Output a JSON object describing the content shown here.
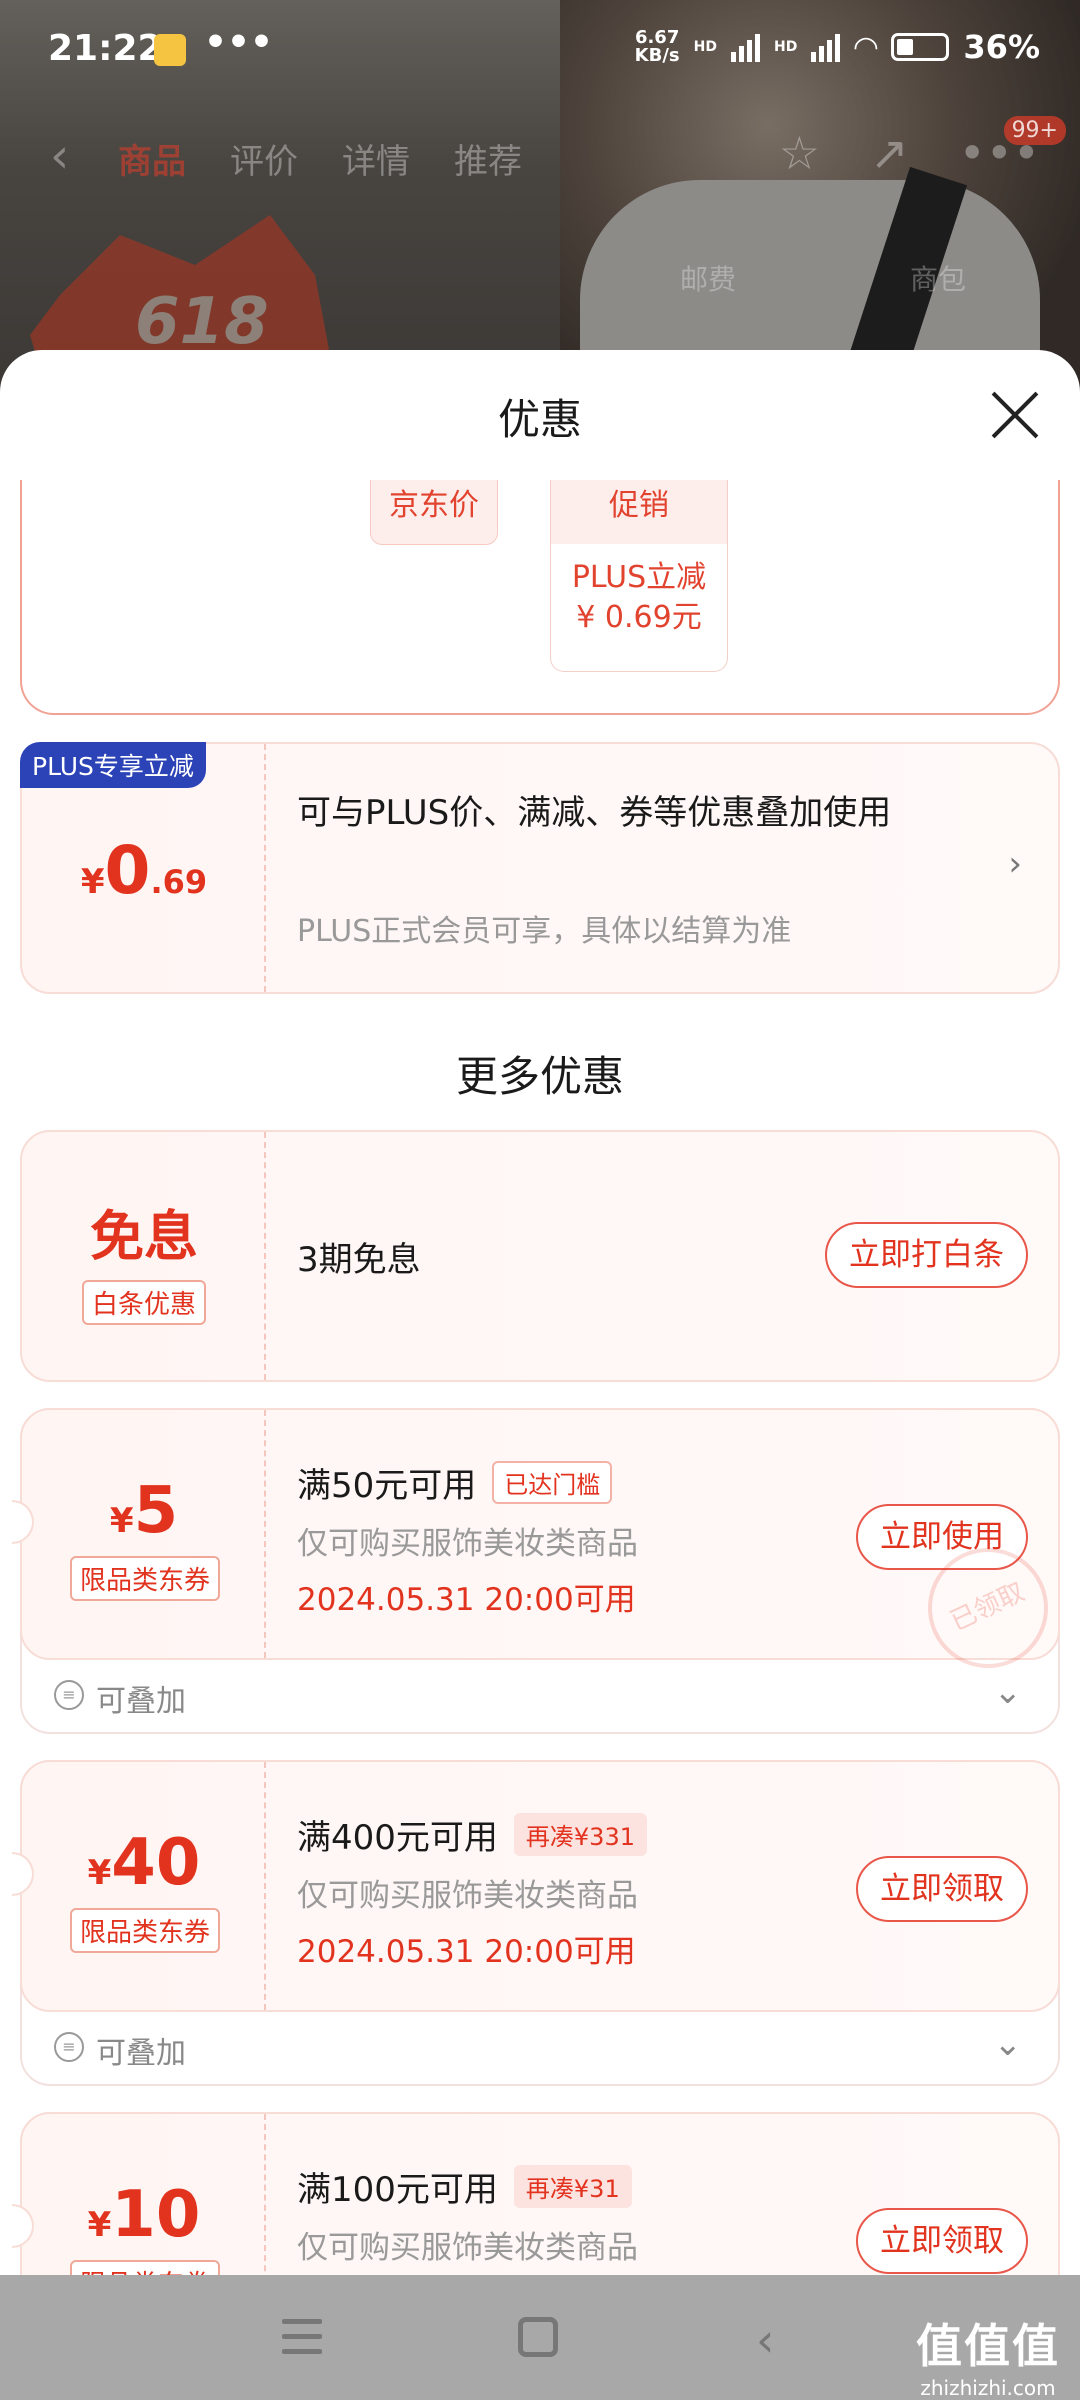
{
  "status": {
    "time": "21:22",
    "dots": "•••",
    "net_speed_top": "6.67",
    "net_speed_bottom": "KB/s",
    "hd1": "HD",
    "hd2": "HD",
    "battery": "36%"
  },
  "bg_nav": {
    "back": "‹",
    "tabs": [
      "商品",
      "评价",
      "详情",
      "推荐"
    ],
    "badge_count": "99+",
    "star": "☆",
    "share": "↗",
    "more": "•••"
  },
  "bg_badge": "618",
  "bg_tags": [
    "邮费",
    "商包"
  ],
  "sheet": {
    "title": "优惠",
    "price_box": {
      "jd_price": "京东价",
      "promo_header": "促销",
      "promo_line1": "PLUS立减",
      "promo_line2": "¥ 0.69元"
    },
    "plus_card": {
      "tag": "PLUS专享立减",
      "currency": "¥",
      "amount_int": "0",
      "amount_dec": ".69",
      "main_text": "可与PLUS价、满减、券等优惠叠加使用",
      "sub_text": "PLUS正式会员可享，具体以结算为准"
    },
    "more_title": "更多优惠",
    "baitiao": {
      "big": "免息",
      "tag": "白条优惠",
      "text": "3期免息",
      "button": "立即打白条"
    },
    "coupons": [
      {
        "currency": "¥",
        "amount": "5",
        "tag": "限品类东券",
        "condition": "满50元可用",
        "pill": "已达门槛",
        "scope": "仅可购买服饰美妆类商品",
        "time": "2024.05.31 20:00可用",
        "button": "立即使用",
        "stack": "可叠加",
        "stamp": "已领取"
      },
      {
        "currency": "¥",
        "amount": "40",
        "tag": "限品类东券",
        "condition": "满400元可用",
        "pill": "再凑¥331",
        "scope": "仅可购买服饰美妆类商品",
        "time": "2024.05.31 20:00可用",
        "button": "立即领取",
        "stack": "可叠加"
      },
      {
        "currency": "¥",
        "amount": "10",
        "tag": "限品类东券",
        "condition": "满100元可用",
        "pill": "再凑¥31",
        "scope": "仅可购买服饰美妆类商品",
        "button": "立即领取"
      }
    ]
  },
  "watermark": {
    "line1": "值值值",
    "line2": "zhizhizhi.com"
  },
  "colors": {
    "accent": "#e2331f",
    "plus_blue": "#2c43b7",
    "card_bg": "#fff6f4"
  }
}
